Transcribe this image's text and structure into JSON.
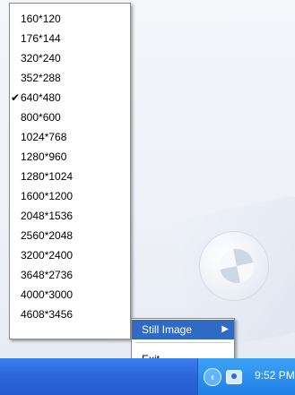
{
  "resolution_menu": {
    "items": [
      {
        "label": "160*120",
        "checked": false
      },
      {
        "label": "176*144",
        "checked": false
      },
      {
        "label": "320*240",
        "checked": false
      },
      {
        "label": "352*288",
        "checked": false
      },
      {
        "label": "640*480",
        "checked": true
      },
      {
        "label": "800*600",
        "checked": false
      },
      {
        "label": "1024*768",
        "checked": false
      },
      {
        "label": "1280*960",
        "checked": false
      },
      {
        "label": "1280*1024",
        "checked": false
      },
      {
        "label": "1600*1200",
        "checked": false
      },
      {
        "label": "2048*1536",
        "checked": false
      },
      {
        "label": "2560*2048",
        "checked": false
      },
      {
        "label": "3200*2400",
        "checked": false
      },
      {
        "label": "3648*2736",
        "checked": false
      },
      {
        "label": "4000*3000",
        "checked": false
      },
      {
        "label": "4608*3456",
        "checked": false
      }
    ],
    "checkmark_glyph": "✔"
  },
  "context_menu": {
    "still_image_label": "Still Image",
    "arrow_glyph": "▶",
    "exit_label": "Exit"
  },
  "taskbar": {
    "clock": "9:52 PM",
    "tray_icons": [
      "back-arrow-icon",
      "camera-icon"
    ]
  },
  "colors": {
    "highlight": "#316ac5",
    "taskbar": "#2b67db",
    "tray": "#2d8fee"
  }
}
